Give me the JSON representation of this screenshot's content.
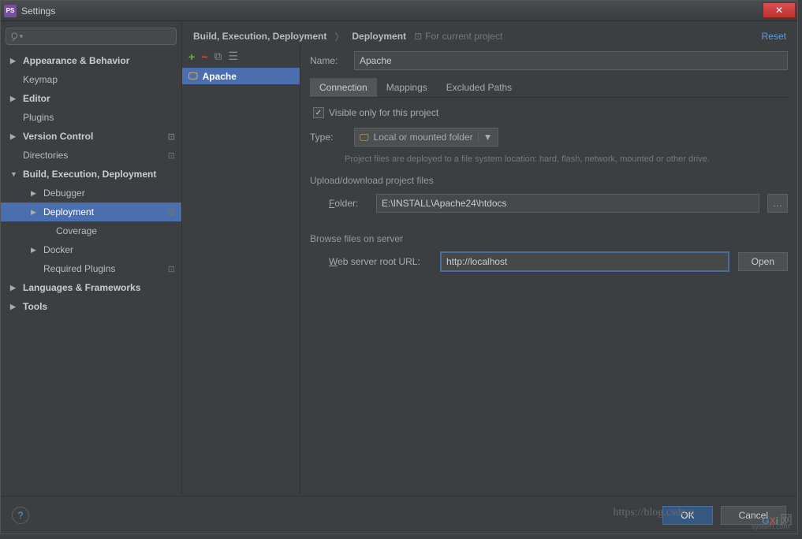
{
  "window": {
    "title": "Settings"
  },
  "sidebar": {
    "items": [
      {
        "label": "Appearance & Behavior",
        "arrow": "▶",
        "bold": true
      },
      {
        "label": "Keymap",
        "arrow": "",
        "bold": false
      },
      {
        "label": "Editor",
        "arrow": "▶",
        "bold": true
      },
      {
        "label": "Plugins",
        "arrow": "",
        "bold": false
      },
      {
        "label": "Version Control",
        "arrow": "▶",
        "bold": true,
        "badge": "⊡"
      },
      {
        "label": "Directories",
        "arrow": "",
        "bold": false,
        "badge": "⊡"
      },
      {
        "label": "Build, Execution, Deployment",
        "arrow": "▼",
        "bold": true
      },
      {
        "label": "Debugger",
        "arrow": "▶",
        "level": 1
      },
      {
        "label": "Deployment",
        "arrow": "▶",
        "level": 1,
        "selected": true,
        "badge": "⊡"
      },
      {
        "label": "Coverage",
        "arrow": "",
        "level": 2
      },
      {
        "label": "Docker",
        "arrow": "▶",
        "level": 1
      },
      {
        "label": "Required Plugins",
        "arrow": "",
        "level": 1,
        "badge": "⊡"
      },
      {
        "label": "Languages & Frameworks",
        "arrow": "▶",
        "bold": true
      },
      {
        "label": "Tools",
        "arrow": "▶",
        "bold": true
      }
    ]
  },
  "breadcrumb": {
    "crumb1": "Build, Execution, Deployment",
    "crumb2": "Deployment",
    "proj_hint": "For current project",
    "reset": "Reset"
  },
  "servers": {
    "selected": "Apache"
  },
  "form": {
    "name_label": "Name:",
    "name_value": "Apache",
    "tabs": {
      "connection": "Connection",
      "mappings": "Mappings",
      "excluded": "Excluded Paths"
    },
    "visible_label": "Visible only for this project",
    "type_label": "Type:",
    "type_value": "Local or mounted folder",
    "hint": "Project files are deployed to a file system location: hard, flash, network, mounted or other drive.",
    "section1": "Upload/download project files",
    "folder_label": "Folder:",
    "folder_value": "E:\\INSTALL\\Apache24\\htdocs",
    "section2": "Browse files on server",
    "url_label": "Web server root URL:",
    "url_value": "http://localhost",
    "open_btn": "Open"
  },
  "footer": {
    "ok": "OK",
    "cancel": "Cancel"
  },
  "watermark": {
    "blog": "https://blog.csdn.n",
    "gxi": "GXi",
    "net": "网",
    "sub": "system.com"
  }
}
